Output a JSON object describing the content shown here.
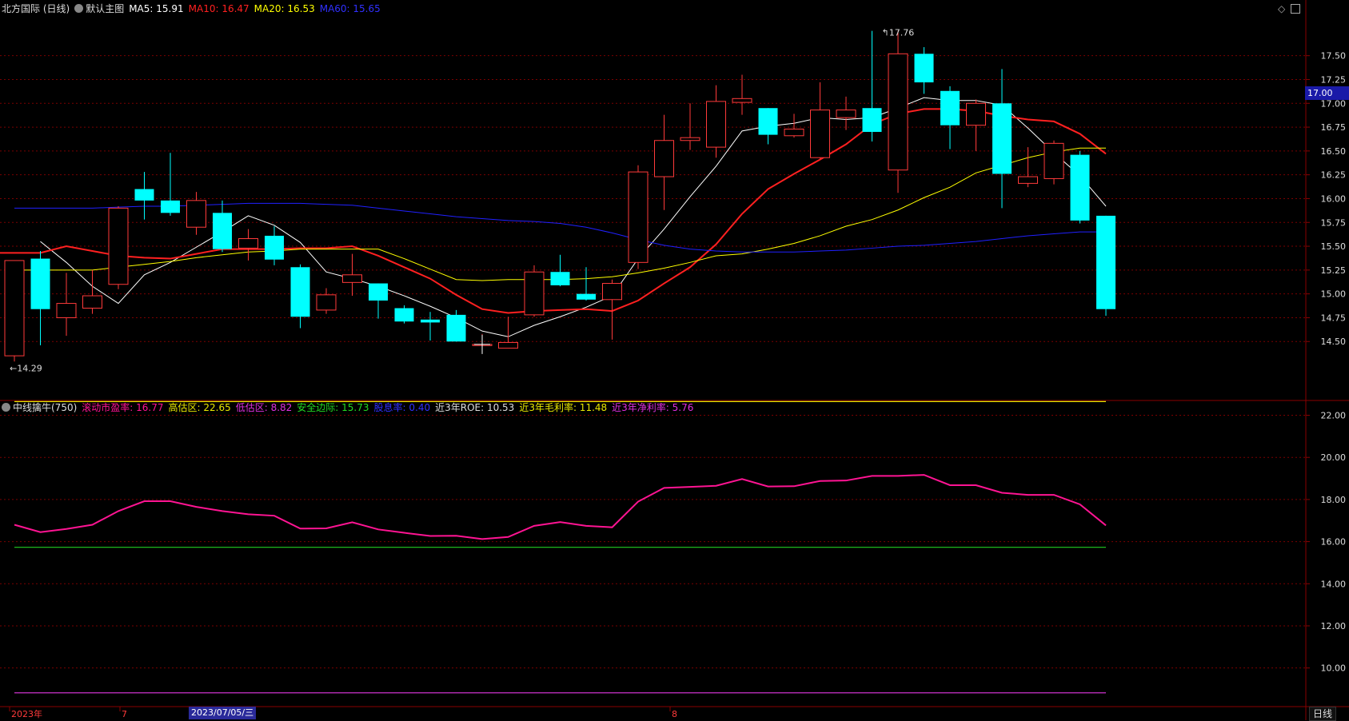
{
  "main_header": {
    "title": "北方国际 (日线)",
    "template": "默认主图",
    "ma5": "MA5: 15.91",
    "ma10": "MA10: 16.47",
    "ma20": "MA20: 16.53",
    "ma60": "MA60: 15.65"
  },
  "sub_header": {
    "title": "中线擒牛(750)",
    "pe": "滚动市盈率: 16.77",
    "high": "高估区: 22.65",
    "low": "低估区: 8.82",
    "safe": "安全边际: 15.73",
    "div": "股息率: 0.40",
    "roe": "近3年ROE: 10.53",
    "gross": "近3年毛利率: 11.48",
    "net": "近3年净利率: 5.76"
  },
  "price_tag": "17.00",
  "period_label": "日线",
  "colors": {
    "up": "#ff3a3a",
    "down": "#00ffff",
    "ma5": "#ffffff",
    "ma10": "#ff2020",
    "ma20": "#ffff00",
    "ma60": "#2020ff",
    "pe_line": "#ff1493",
    "high_line": "#e8e800",
    "safe_line": "#22cc22",
    "low_line": "#cc33cc",
    "grid": "#7a0000"
  },
  "chart_data": [
    {
      "type": "candlestick",
      "ylim": [
        14.2,
        17.9
      ],
      "y_ticks": [
        "17.50",
        "17.25",
        "17.00",
        "16.75",
        "16.50",
        "16.25",
        "16.00",
        "15.75",
        "15.50",
        "15.25",
        "15.00",
        "14.75",
        "14.50"
      ],
      "x_labels": [
        "2023年",
        "7",
        "2023/07/05/三",
        "8"
      ],
      "annotations": {
        "high": "17.76",
        "low": "14.29"
      },
      "candles": [
        {
          "o": 14.35,
          "h": 14.35,
          "l": 14.29,
          "c": 15.35
        },
        {
          "o": 15.37,
          "h": 15.45,
          "l": 14.46,
          "c": 14.84
        },
        {
          "o": 14.75,
          "h": 15.22,
          "l": 14.56,
          "c": 14.9
        },
        {
          "o": 14.85,
          "h": 15.25,
          "l": 14.79,
          "c": 14.98
        },
        {
          "o": 15.1,
          "h": 15.92,
          "l": 15.05,
          "c": 15.9
        },
        {
          "o": 16.1,
          "h": 16.28,
          "l": 15.78,
          "c": 15.98
        },
        {
          "o": 15.98,
          "h": 16.48,
          "l": 15.82,
          "c": 15.85
        },
        {
          "o": 15.7,
          "h": 16.07,
          "l": 15.62,
          "c": 15.98
        },
        {
          "o": 15.85,
          "h": 15.98,
          "l": 15.44,
          "c": 15.47
        },
        {
          "o": 15.48,
          "h": 15.68,
          "l": 15.35,
          "c": 15.58
        },
        {
          "o": 15.61,
          "h": 15.71,
          "l": 15.3,
          "c": 15.36
        },
        {
          "o": 15.28,
          "h": 15.31,
          "l": 14.64,
          "c": 14.76
        },
        {
          "o": 14.83,
          "h": 15.06,
          "l": 14.79,
          "c": 14.99
        },
        {
          "o": 15.12,
          "h": 15.42,
          "l": 14.98,
          "c": 15.2
        },
        {
          "o": 15.11,
          "h": 15.11,
          "l": 14.74,
          "c": 14.93
        },
        {
          "o": 14.85,
          "h": 14.88,
          "l": 14.69,
          "c": 14.71
        },
        {
          "o": 14.73,
          "h": 14.81,
          "l": 14.51,
          "c": 14.7
        },
        {
          "o": 14.78,
          "h": 14.83,
          "l": 14.5,
          "c": 14.5
        },
        {
          "o": 14.47,
          "h": 14.58,
          "l": 14.38,
          "c": 14.47
        },
        {
          "o": 14.43,
          "h": 14.76,
          "l": 14.44,
          "c": 14.49
        },
        {
          "o": 14.78,
          "h": 15.3,
          "l": 14.76,
          "c": 15.23
        },
        {
          "o": 15.23,
          "h": 15.41,
          "l": 15.08,
          "c": 15.09
        },
        {
          "o": 15.0,
          "h": 15.28,
          "l": 14.93,
          "c": 14.94
        },
        {
          "o": 14.94,
          "h": 15.15,
          "l": 14.52,
          "c": 15.11
        },
        {
          "o": 15.33,
          "h": 16.35,
          "l": 15.26,
          "c": 16.28
        },
        {
          "o": 16.23,
          "h": 16.88,
          "l": 15.88,
          "c": 16.61
        },
        {
          "o": 16.61,
          "h": 17.0,
          "l": 16.51,
          "c": 16.64
        },
        {
          "o": 16.54,
          "h": 17.19,
          "l": 16.43,
          "c": 17.02
        },
        {
          "o": 17.01,
          "h": 17.3,
          "l": 16.88,
          "c": 17.05
        },
        {
          "o": 16.95,
          "h": 16.95,
          "l": 16.57,
          "c": 16.67
        },
        {
          "o": 16.66,
          "h": 16.89,
          "l": 16.64,
          "c": 16.73
        },
        {
          "o": 16.43,
          "h": 17.22,
          "l": 16.42,
          "c": 16.93
        },
        {
          "o": 16.85,
          "h": 17.07,
          "l": 16.72,
          "c": 16.93
        },
        {
          "o": 16.95,
          "h": 17.76,
          "l": 16.6,
          "c": 16.7
        },
        {
          "o": 16.3,
          "h": 17.76,
          "l": 16.06,
          "c": 17.52
        },
        {
          "o": 17.52,
          "h": 17.59,
          "l": 17.1,
          "c": 17.22
        },
        {
          "o": 17.13,
          "h": 17.18,
          "l": 16.52,
          "c": 16.77
        },
        {
          "o": 16.77,
          "h": 17.04,
          "l": 16.5,
          "c": 17.0
        },
        {
          "o": 17.0,
          "h": 17.36,
          "l": 15.9,
          "c": 16.26
        },
        {
          "o": 16.16,
          "h": 16.54,
          "l": 16.12,
          "c": 16.23
        },
        {
          "o": 16.21,
          "h": 16.61,
          "l": 16.15,
          "c": 16.58
        },
        {
          "o": 16.46,
          "h": 16.5,
          "l": 15.74,
          "c": 15.77
        },
        {
          "o": 15.82,
          "h": 15.82,
          "l": 14.77,
          "c": 14.84
        }
      ],
      "series": [
        {
          "name": "MA5",
          "values": [
            15.55,
            15.33,
            15.08,
            14.9,
            15.2,
            15.33,
            15.49,
            15.65,
            15.82,
            15.72,
            15.54,
            15.23,
            15.16,
            15.08,
            14.98,
            14.87,
            14.75,
            14.61,
            14.55,
            14.67,
            14.76,
            14.86,
            14.98,
            15.37,
            15.68,
            16.02,
            16.34,
            16.71,
            16.76,
            16.79,
            16.85,
            16.83,
            16.85,
            16.95,
            17.06,
            17.03,
            17.03,
            16.98,
            16.74,
            16.48,
            16.24,
            15.92
          ]
        },
        {
          "name": "MA10",
          "values": [
            15.45,
            15.43,
            15.43,
            15.43,
            15.5,
            15.45,
            15.4,
            15.38,
            15.37,
            15.42,
            15.47,
            15.47,
            15.47,
            15.48,
            15.48,
            15.5,
            15.4,
            15.28,
            15.16,
            14.99,
            14.84,
            14.8,
            14.82,
            14.83,
            14.84,
            14.82,
            14.93,
            15.11,
            15.28,
            15.52,
            15.84,
            16.1,
            16.26,
            16.41,
            16.57,
            16.78,
            16.89,
            16.94,
            16.94,
            16.92,
            16.87,
            16.83,
            16.81,
            16.68,
            16.47
          ]
        },
        {
          "name": "MA20",
          "values": [
            15.25,
            15.25,
            15.25,
            15.25,
            15.28,
            15.31,
            15.34,
            15.38,
            15.41,
            15.44,
            15.45,
            15.47,
            15.47,
            15.47,
            15.47,
            15.37,
            15.26,
            15.15,
            15.14,
            15.15,
            15.15,
            15.15,
            15.16,
            15.18,
            15.22,
            15.27,
            15.33,
            15.4,
            15.42,
            15.47,
            15.53,
            15.61,
            15.71,
            15.78,
            15.88,
            16.01,
            16.12,
            16.27,
            16.35,
            16.43,
            16.49,
            16.53,
            16.53
          ]
        },
        {
          "name": "MA60",
          "values": [
            15.9,
            15.9,
            15.9,
            15.9,
            15.91,
            15.92,
            15.92,
            15.93,
            15.94,
            15.95,
            15.95,
            15.95,
            15.94,
            15.93,
            15.9,
            15.87,
            15.84,
            15.81,
            15.79,
            15.77,
            15.76,
            15.74,
            15.7,
            15.64,
            15.57,
            15.51,
            15.47,
            15.45,
            15.44,
            15.44,
            15.44,
            15.45,
            15.46,
            15.48,
            15.5,
            15.51,
            15.53,
            15.55,
            15.58,
            15.61,
            15.63,
            15.65,
            15.65
          ]
        }
      ]
    },
    {
      "type": "line",
      "ylim": [
        9.0,
        23.5
      ],
      "y_ticks": [
        "22.00",
        "20.00",
        "18.00",
        "16.00",
        "14.00",
        "12.00",
        "10.00"
      ],
      "series": [
        {
          "name": "滚动市盈率",
          "values": [
            16.8,
            16.45,
            16.6,
            16.8,
            17.45,
            17.92,
            17.92,
            17.65,
            17.45,
            17.3,
            17.23,
            16.62,
            16.63,
            16.92,
            16.58,
            16.42,
            16.27,
            16.28,
            16.12,
            16.22,
            16.75,
            16.93,
            16.75,
            16.68,
            17.9,
            18.55,
            18.6,
            18.65,
            18.97,
            18.62,
            18.63,
            18.88,
            18.9,
            19.12,
            19.12,
            19.17,
            18.68,
            18.68,
            18.32,
            18.22,
            18.22,
            17.77,
            16.77
          ]
        },
        {
          "name": "高估区",
          "values": [
            22.65
          ]
        },
        {
          "name": "安全边际",
          "values": [
            15.73
          ]
        },
        {
          "name": "低估区",
          "values": [
            8.82
          ]
        }
      ]
    }
  ]
}
